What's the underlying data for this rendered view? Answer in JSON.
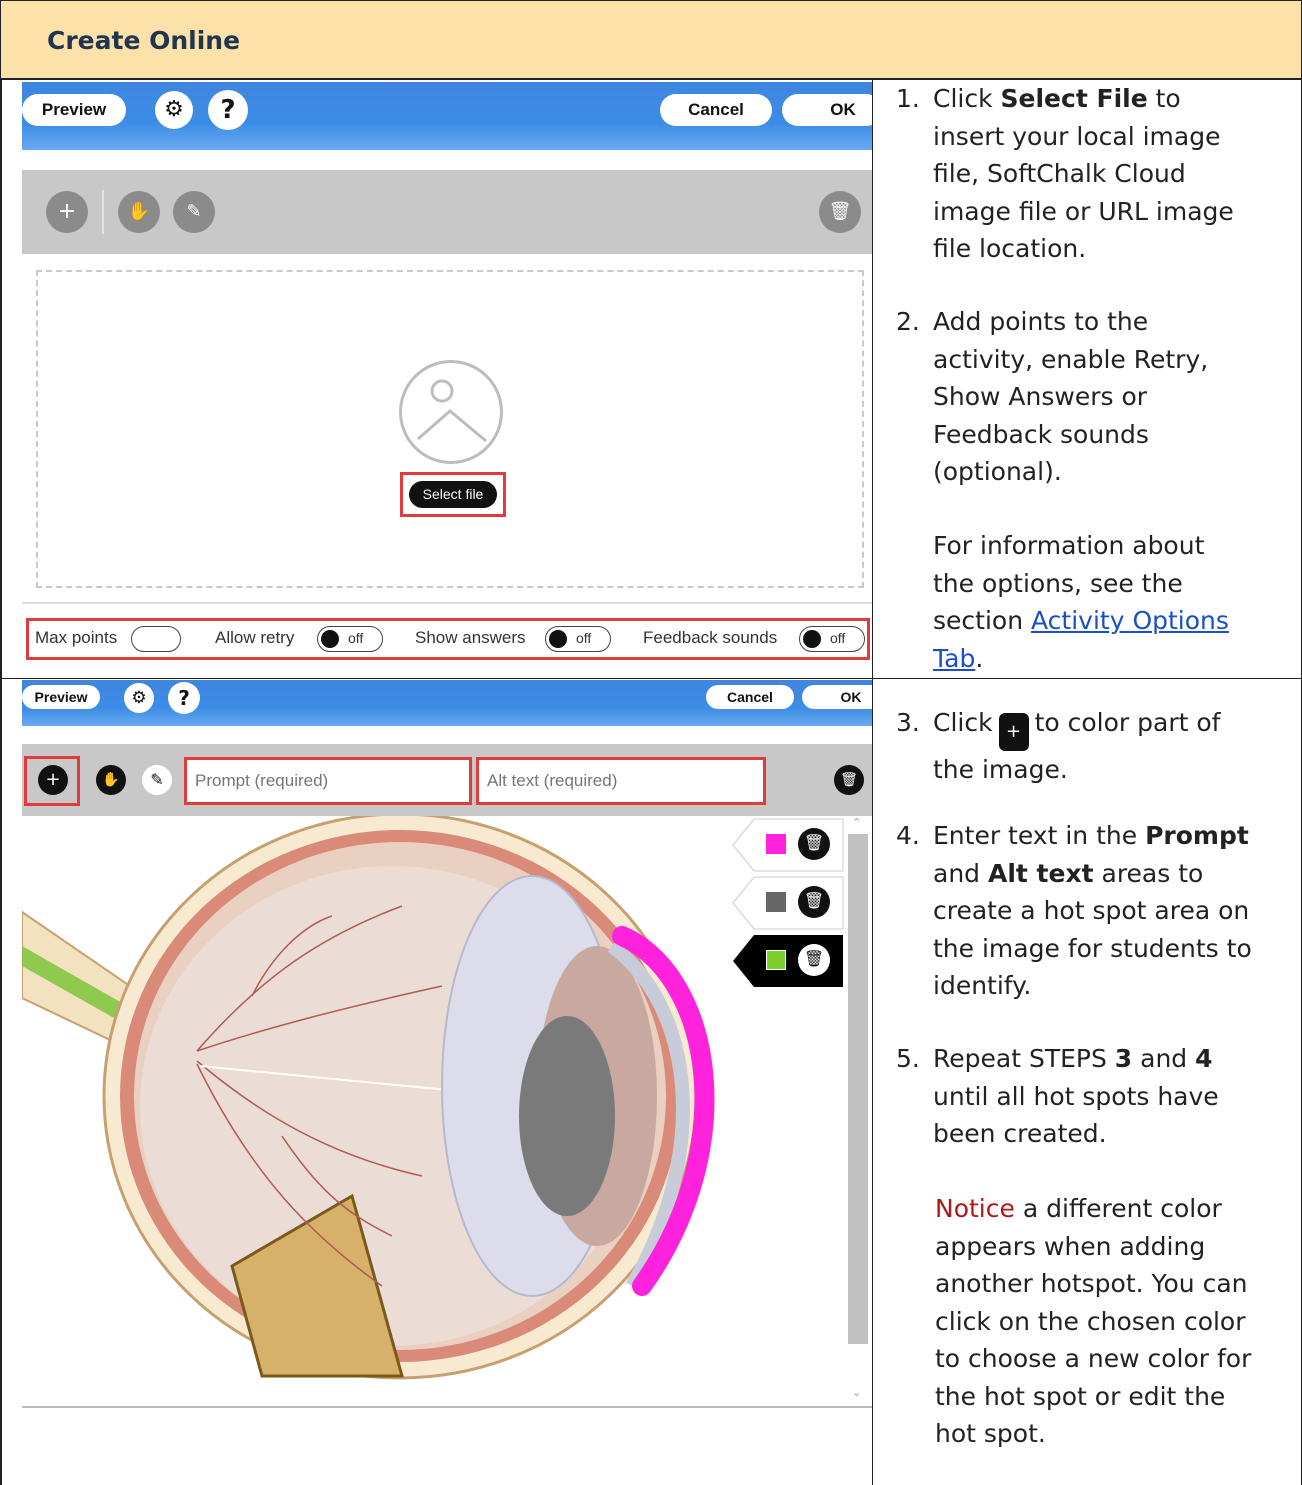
{
  "header": {
    "title": "Create Online"
  },
  "panel1": {
    "preview": "Preview",
    "settings_icon": "gear-icon",
    "help": "?",
    "cancel": "Cancel",
    "ok": "OK",
    "select_file": "Select file",
    "options": {
      "max_points": "Max points",
      "allow_retry": "Allow retry",
      "show_answers": "Show answers",
      "feedback_sounds": "Feedback sounds",
      "off": "off"
    }
  },
  "panel2": {
    "preview": "Preview",
    "help": "?",
    "cancel": "Cancel",
    "ok": "OK",
    "prompt_placeholder": "Prompt (required)",
    "alt_placeholder": "Alt text (required)",
    "hotspots": [
      {
        "color": "#ff22dd",
        "active": false
      },
      {
        "color": "#666666",
        "active": false
      },
      {
        "color": "#7ccf2a",
        "active": true
      }
    ]
  },
  "instructions": {
    "s1_num": "1.",
    "s1_a": "Click ",
    "s1_b": "Select File",
    "s1_c": " to",
    "s1_l2": "insert your local image",
    "s1_l3": "file, SoftChalk Cloud",
    "s1_l4": "image file or URL image",
    "s1_l5": "file location.",
    "s2_num": "2.",
    "s2_l1": "Add points to the",
    "s2_l2": "activity, enable Retry,",
    "s2_l3": "Show Answers or",
    "s2_l4": "Feedback sounds",
    "s2_l5": "(optional).",
    "info_l1": "For information about",
    "info_l2": "the options, see the",
    "info_l3": "section ",
    "info_link1": "Activity Options",
    "info_link2": "Tab",
    "info_end": ".",
    "s3_num": "3.",
    "s3_a": "Click",
    "s3_b": "to color part of",
    "s3_l2": "the image.",
    "s4_num": "4.",
    "s4_a": "Enter text in the ",
    "s4_b": "Prompt",
    "s4_c": "and ",
    "s4_d": "Alt text",
    "s4_e": " areas to",
    "s4_l3": "create a hot spot area on",
    "s4_l4": "the image for students to",
    "s4_l5": "identify.",
    "s5_num": "5.",
    "s5_a": "Repeat STEPS ",
    "s5_b": "3",
    "s5_c": " and ",
    "s5_d": "4",
    "s5_l2": "until all hot spots have",
    "s5_l3": "been created.",
    "notice": "Notice",
    "n_l1": " a different color",
    "n_l2": "appears when adding",
    "n_l3": "another hotspot. You can",
    "n_l4": "click on the chosen color",
    "n_l5": "to choose a new color for",
    "n_l6": "the hot spot or edit the",
    "n_l7": "hot spot."
  }
}
